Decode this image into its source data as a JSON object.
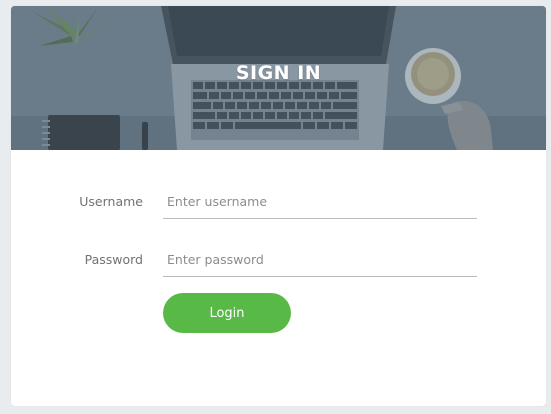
{
  "header": {
    "title": "SIGN IN"
  },
  "form": {
    "username": {
      "label": "Username",
      "placeholder": "Enter username",
      "value": ""
    },
    "password": {
      "label": "Password",
      "placeholder": "Enter password",
      "value": ""
    },
    "login_label": "Login"
  },
  "colors": {
    "accent": "#58b947",
    "hero_overlay": "#6b7c8a",
    "page_background": "#e9ecee"
  },
  "icons": [
    "plant-image",
    "laptop-image",
    "coffee-cup-image",
    "notebook-image",
    "pen-image",
    "hand-image"
  ]
}
